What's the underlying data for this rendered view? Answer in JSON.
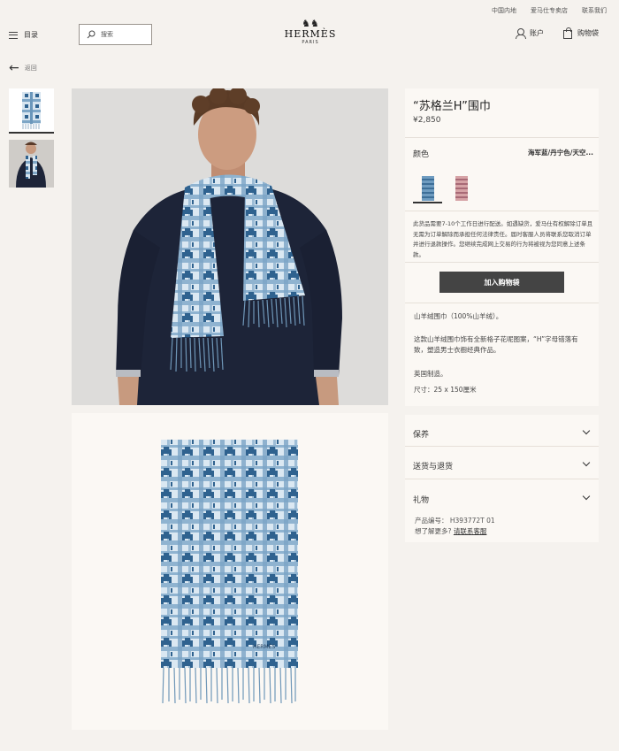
{
  "top_links": [
    "中国内地",
    "爱马仕专卖店",
    "联系我们"
  ],
  "header": {
    "menu_label": "目录",
    "search_placeholder": "搜索",
    "logo_brand": "HERMÈS",
    "logo_city": "PARIS",
    "account_label": "账户",
    "cart_label": "购物袋"
  },
  "back_label": "返回",
  "product": {
    "title": "“苏格兰H”围巾",
    "price": "¥2,850",
    "color_label": "颜色",
    "color_value": "海军蓝/丹宁色/天空...",
    "notice": "此货品需要7-10个工作日进行配送。如遇缺货，爱马仕有权解除订单且无需为订单解除而承担任何法律责任。届时客服人员将联系您取消订单并进行退款操作。您继续完成网上交易的行为将被视为您同意上述条款。",
    "add_to_cart": "加入购物袋",
    "material": "山羊绒围巾（100%山羊绒）。",
    "description": "这款山羊绒围巾饰有全新格子花呢图案，“H”字母错落有致，塑造男士衣橱经典作品。",
    "made_in": "英国制造。",
    "size": "尺寸：25 x 150厘米",
    "scarf_label": "HERMÈS"
  },
  "accordion": [
    "保养",
    "送货与退货",
    "礼物"
  ],
  "meta": {
    "product_code": "产品编号：  H393772T 01",
    "help_text": "想了解更多?",
    "help_link": "请联系客服"
  },
  "colors": {
    "scarf_dark": "#3f6f99",
    "scarf_light": "#d7e5f1",
    "sweater": "#1d2438",
    "button": "#444444"
  }
}
